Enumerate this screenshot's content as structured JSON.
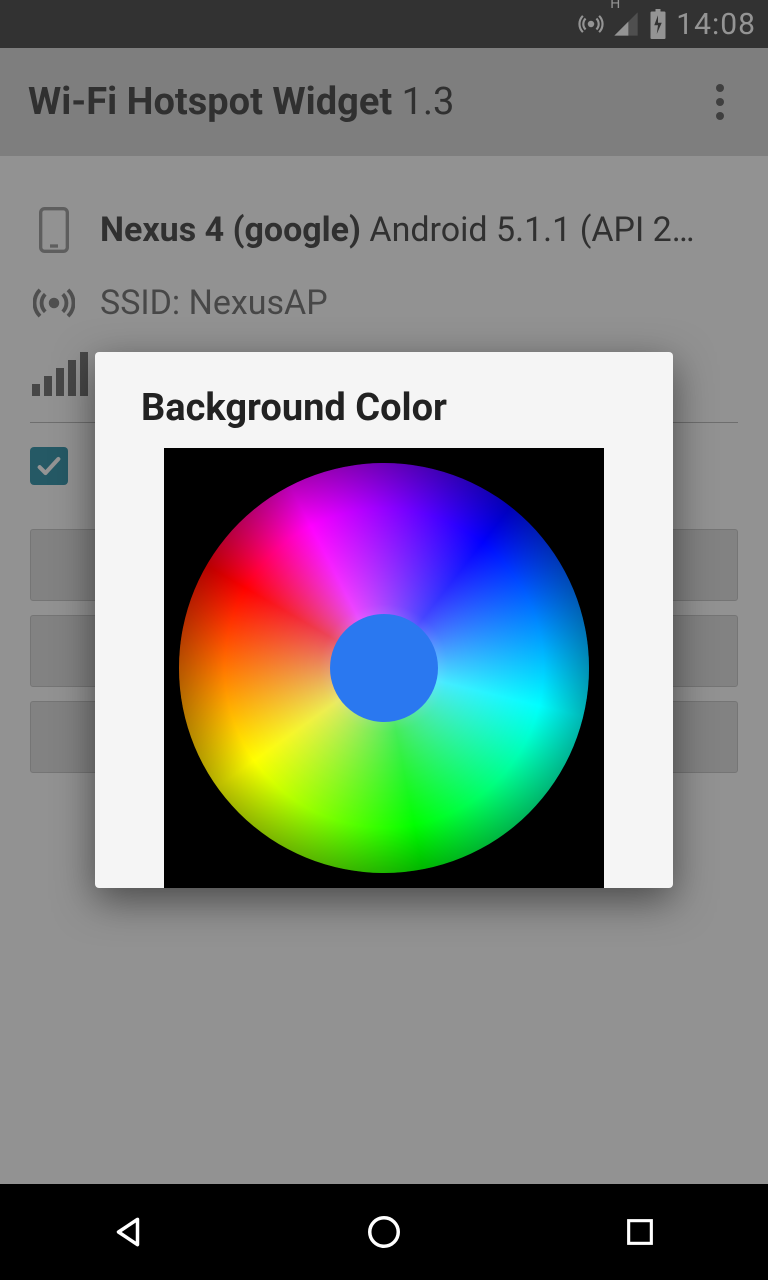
{
  "status": {
    "time": "14:08",
    "network_indicator": "H"
  },
  "appbar": {
    "title_bold": "Wi-Fi Hotspot Widget",
    "title_version": " 1.3"
  },
  "device": {
    "name_bold": "Nexus 4 (google)",
    "os_text": " Android 5.1.1 (API 2…"
  },
  "ssid": {
    "label": "SSID: NexusAP"
  },
  "dialog": {
    "title": "Background Color",
    "selected_color": "#2a78f0"
  }
}
